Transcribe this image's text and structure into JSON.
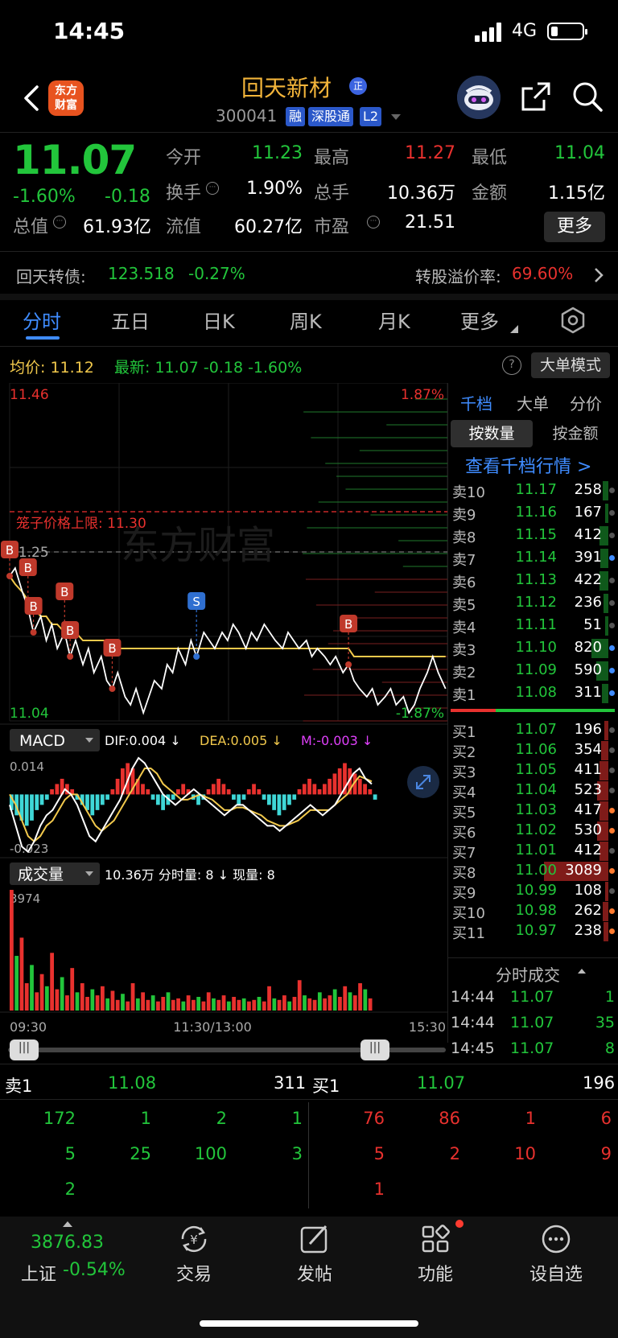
{
  "status": {
    "time": "14:45",
    "network": "4G"
  },
  "header": {
    "logo_text": "东方财富",
    "stock_name": "回天新材",
    "zheng_badge": "正",
    "stock_code": "300041",
    "tags": [
      "融",
      "深股通",
      "L2"
    ]
  },
  "quote": {
    "price": "11.07",
    "change_pct": "-1.60%",
    "change": "-0.18",
    "fields": [
      {
        "label": "今开",
        "value": "11.23",
        "color": "green"
      },
      {
        "label": "最高",
        "value": "11.27",
        "color": "red"
      },
      {
        "label": "最低",
        "value": "11.04",
        "color": "green"
      },
      {
        "label": "换手",
        "value": "1.90%",
        "color": "white"
      },
      {
        "label": "总手",
        "value": "10.36万",
        "color": "white"
      },
      {
        "label": "金额",
        "value": "1.15亿",
        "color": "white"
      },
      {
        "label": "总值",
        "value": "61.93亿",
        "color": "white"
      },
      {
        "label": "流值",
        "value": "60.27亿",
        "color": "white"
      },
      {
        "label": "市盈",
        "label_sup": "动",
        "value": "21.51",
        "color": "white"
      }
    ],
    "more_label": "更多"
  },
  "bond": {
    "label": "回天转债:",
    "price": "123.518",
    "change": "-0.27%",
    "premium_label": "转股溢价率:",
    "premium_value": "69.60%"
  },
  "tabs": [
    "分时",
    "五日",
    "日K",
    "周K",
    "月K",
    "更多"
  ],
  "chart_header": {
    "avg_label": "均价: 11.12",
    "latest_label": "最新: 11.07  -0.18  -1.60%",
    "big_order_mode": "大单模式",
    "help": "?"
  },
  "chart_data": {
    "type": "line",
    "price_axis": {
      "top": "11.46",
      "top_pct": "1.87%",
      "bottom": "11.04",
      "bottom_pct": "-1.87%",
      "ref": "11.25"
    },
    "cage_label": "笼子价格上限: 11.30",
    "cage_price": 11.3,
    "ylim": [
      11.04,
      11.46
    ],
    "watermark": "东方财富",
    "price": [
      11.22,
      11.23,
      11.2,
      11.18,
      11.15,
      11.17,
      11.14,
      11.16,
      11.13,
      11.15,
      11.12,
      11.14,
      11.11,
      11.13,
      11.1,
      11.12,
      11.09,
      11.08,
      11.1,
      11.07,
      11.06,
      11.08,
      11.05,
      11.07,
      11.09,
      11.08,
      11.11,
      11.1,
      11.13,
      11.11,
      11.14,
      11.12,
      11.15,
      11.14,
      11.13,
      11.15,
      11.14,
      11.16,
      11.15,
      11.13,
      11.15,
      11.14,
      11.16,
      11.15,
      11.14,
      11.13,
      11.15,
      11.14,
      11.13,
      11.14,
      11.12,
      11.13,
      11.12,
      11.11,
      11.12,
      11.1,
      11.11,
      11.09,
      11.08,
      11.07,
      11.08,
      11.06,
      11.07,
      11.08,
      11.06,
      11.07,
      11.05,
      11.06,
      11.08,
      11.1,
      11.12,
      11.1,
      11.08
    ],
    "avg": [
      11.22,
      11.21,
      11.2,
      11.19,
      11.18,
      11.17,
      11.17,
      11.16,
      11.16,
      11.15,
      11.15,
      11.15,
      11.14,
      11.14,
      11.14,
      11.14,
      11.14,
      11.13,
      11.13,
      11.13,
      11.13,
      11.13,
      11.13,
      11.13,
      11.13,
      11.13,
      11.13,
      11.13,
      11.13,
      11.13,
      11.13,
      11.13,
      11.13,
      11.13,
      11.13,
      11.13,
      11.13,
      11.13,
      11.13,
      11.13,
      11.13,
      11.13,
      11.13,
      11.13,
      11.13,
      11.13,
      11.13,
      11.13,
      11.13,
      11.13,
      11.13,
      11.13,
      11.13,
      11.13,
      11.13,
      11.13,
      11.13,
      11.12,
      11.12,
      11.12,
      11.12,
      11.12,
      11.12,
      11.12,
      11.12,
      11.12,
      11.12,
      11.12,
      11.12,
      11.12,
      11.12,
      11.12,
      11.12
    ],
    "signals": [
      {
        "label": "B",
        "type": "buy",
        "i": 0
      },
      {
        "label": "B",
        "type": "buy",
        "i": 3
      },
      {
        "label": "B",
        "type": "buy",
        "i": 4
      },
      {
        "label": "B",
        "type": "buy",
        "i": 9
      },
      {
        "label": "B",
        "type": "buy",
        "i": 10
      },
      {
        "label": "B",
        "type": "buy",
        "i": 17
      },
      {
        "label": "S",
        "type": "sell",
        "i": 31
      },
      {
        "label": "B",
        "type": "buy",
        "i": 56
      }
    ],
    "x_ticks": [
      "09:30",
      "11:30/13:00",
      "15:30"
    ],
    "macd": {
      "selector": "MACD",
      "dif_label": "DIF:0.004 ↓",
      "dea_label": "DEA:0.005 ↓",
      "m_label": "M:-0.003 ↓",
      "ymax_label": "0.014",
      "ymin_label": "-0.023",
      "ylim": [
        -0.023,
        0.014
      ],
      "hist": [
        -0.006,
        -0.008,
        -0.01,
        -0.012,
        -0.01,
        -0.006,
        -0.004,
        -0.002,
        0.002,
        0.004,
        0.006,
        0.004,
        0.002,
        -0.002,
        -0.004,
        -0.006,
        -0.008,
        -0.006,
        -0.004,
        -0.002,
        0.002,
        0.006,
        0.01,
        0.012,
        0.01,
        0.006,
        0.004,
        0.002,
        -0.002,
        -0.004,
        -0.006,
        -0.004,
        -0.002,
        0.002,
        0.004,
        0.002,
        -0.002,
        -0.004,
        -0.002,
        0.002,
        0.004,
        0.006,
        0.004,
        0.002,
        -0.002,
        -0.004,
        -0.002,
        0.002,
        0.004,
        0.002,
        -0.002,
        -0.004,
        -0.006,
        -0.008,
        -0.006,
        -0.004,
        -0.002,
        0.002,
        0.004,
        0.006,
        0.004,
        0.002,
        0.004,
        0.006,
        0.008,
        0.01,
        0.012,
        0.01,
        0.008,
        0.006,
        0.004,
        0.002,
        -0.002
      ],
      "dif": [
        -0.004,
        -0.012,
        -0.02,
        -0.022,
        -0.018,
        -0.012,
        -0.008,
        -0.006,
        -0.002,
        0.002,
        0.0,
        -0.004,
        -0.01,
        -0.016,
        -0.018,
        -0.014,
        -0.01,
        -0.006,
        -0.002,
        0.004,
        0.01,
        0.014,
        0.012,
        0.008,
        0.004,
        0.0,
        -0.002,
        -0.004,
        -0.002,
        0.0,
        0.002,
        0.0,
        -0.002,
        -0.004,
        -0.006,
        -0.008,
        -0.006,
        -0.004,
        -0.004,
        -0.006,
        -0.008,
        -0.01,
        -0.012,
        -0.012,
        -0.014,
        -0.012,
        -0.01,
        -0.008,
        -0.006,
        -0.004,
        -0.006,
        -0.008,
        -0.006,
        -0.004,
        0.0,
        0.004,
        0.008,
        0.01,
        0.006,
        0.004
      ],
      "dea": [
        0.0,
        -0.004,
        -0.01,
        -0.016,
        -0.018,
        -0.016,
        -0.012,
        -0.01,
        -0.006,
        -0.002,
        0.0,
        0.0,
        -0.004,
        -0.008,
        -0.012,
        -0.014,
        -0.012,
        -0.01,
        -0.006,
        -0.002,
        0.002,
        0.006,
        0.01,
        0.01,
        0.008,
        0.004,
        0.002,
        0.0,
        -0.002,
        -0.002,
        -0.001,
        0.0,
        -0.001,
        -0.002,
        -0.004,
        -0.006,
        -0.006,
        -0.005,
        -0.005,
        -0.006,
        -0.007,
        -0.008,
        -0.01,
        -0.011,
        -0.012,
        -0.012,
        -0.011,
        -0.01,
        -0.008,
        -0.006,
        -0.006,
        -0.006,
        -0.006,
        -0.004,
        -0.002,
        0.0,
        0.004,
        0.007,
        0.006,
        0.005
      ]
    },
    "volume": {
      "selector": "成交量",
      "summary": "10.36万 分时量: 8 ↓ 现量: 8",
      "ymax_label": "3974",
      "ymax": 3974,
      "bars": [
        3974,
        1800,
        2400,
        900,
        1500,
        600,
        1200,
        800,
        1900,
        700,
        1100,
        500,
        1400,
        600,
        900,
        450,
        700,
        500,
        800,
        400,
        650,
        350,
        550,
        300,
        900,
        400,
        600,
        350,
        500,
        300,
        450,
        600,
        350,
        400,
        300,
        500,
        350,
        450,
        300,
        600,
        400,
        350,
        500,
        300,
        450,
        350,
        400,
        300,
        350,
        450,
        300,
        800,
        400,
        350,
        500,
        300,
        450,
        1000,
        500,
        400,
        350,
        600,
        400,
        500,
        700,
        450,
        800,
        600,
        500,
        900,
        700,
        400
      ]
    }
  },
  "orderbook": {
    "tabs": [
      "千档",
      "大单",
      "分价"
    ],
    "toggles": [
      "按数量",
      "按金额"
    ],
    "view_depth": "查看千档行情 >",
    "asks": [
      {
        "label": "卖10",
        "price": "11.17",
        "qty": "258"
      },
      {
        "label": "卖9",
        "price": "11.16",
        "qty": "167"
      },
      {
        "label": "卖8",
        "price": "11.15",
        "qty": "412"
      },
      {
        "label": "卖7",
        "price": "11.14",
        "qty": "391"
      },
      {
        "label": "卖6",
        "price": "11.13",
        "qty": "422"
      },
      {
        "label": "卖5",
        "price": "11.12",
        "qty": "236"
      },
      {
        "label": "卖4",
        "price": "11.11",
        "qty": "51"
      },
      {
        "label": "卖3",
        "price": "11.10",
        "qty": "820"
      },
      {
        "label": "卖2",
        "price": "11.09",
        "qty": "590"
      },
      {
        "label": "卖1",
        "price": "11.08",
        "qty": "311"
      }
    ],
    "bids": [
      {
        "label": "买1",
        "price": "11.07",
        "qty": "196"
      },
      {
        "label": "买2",
        "price": "11.06",
        "qty": "354"
      },
      {
        "label": "买3",
        "price": "11.05",
        "qty": "411"
      },
      {
        "label": "买4",
        "price": "11.04",
        "qty": "523"
      },
      {
        "label": "买5",
        "price": "11.03",
        "qty": "417"
      },
      {
        "label": "买6",
        "price": "11.02",
        "qty": "530"
      },
      {
        "label": "买7",
        "price": "11.01",
        "qty": "412"
      },
      {
        "label": "买8",
        "price": "11.00",
        "qty": "3089"
      },
      {
        "label": "买9",
        "price": "10.99",
        "qty": "108"
      },
      {
        "label": "买10",
        "price": "10.98",
        "qty": "262"
      },
      {
        "label": "买11",
        "price": "10.97",
        "qty": "238"
      }
    ],
    "ticks_title": "分时成交",
    "ticks": [
      {
        "time": "14:44",
        "price": "11.07",
        "vol": "1"
      },
      {
        "time": "14:44",
        "price": "11.07",
        "vol": "35"
      },
      {
        "time": "14:45",
        "price": "11.07",
        "vol": "8"
      }
    ]
  },
  "level1": {
    "sell_label": "卖1",
    "sell_price": "11.08",
    "sell_qty": "311",
    "buy_label": "买1",
    "buy_price": "11.07",
    "buy_qty": "196",
    "sell_queue": [
      "172",
      "1",
      "2",
      "1",
      "5",
      "25",
      "100",
      "3",
      "2"
    ],
    "buy_queue": [
      "76",
      "86",
      "1",
      "6",
      "5",
      "2",
      "10",
      "9",
      "1"
    ]
  },
  "bottom_nav": {
    "index_value": "3876.83",
    "index_name": "上证",
    "index_change": "-0.54%",
    "items": [
      "交易",
      "发帖",
      "功能",
      "设自选"
    ]
  },
  "colors": {
    "up": "#e8312e",
    "down": "#22c53b",
    "accent": "#3f8cff",
    "avg": "#f2c94c"
  }
}
